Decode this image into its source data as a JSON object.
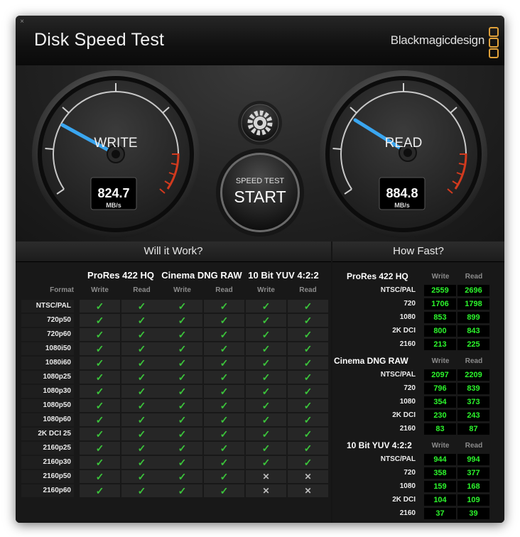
{
  "window": {
    "title": "Disk Speed Test",
    "brand": "Blackmagicdesign",
    "close_glyph": "×"
  },
  "gauges": {
    "write": {
      "label": "WRITE",
      "value": "824.7",
      "unit": "MB/s"
    },
    "read": {
      "label": "READ",
      "value": "884.8",
      "unit": "MB/s"
    },
    "start_button": {
      "top_label": "SPEED TEST",
      "label": "START"
    },
    "settings_icon": "gear-icon"
  },
  "will_it_work": {
    "title": "Will it Work?",
    "format_header": "Format",
    "groups": [
      {
        "name": "ProRes 422 HQ",
        "write": "Write",
        "read": "Read"
      },
      {
        "name": "Cinema DNG RAW",
        "write": "Write",
        "read": "Read"
      },
      {
        "name": "10 Bit YUV 4:2:2",
        "write": "Write",
        "read": "Read"
      }
    ],
    "rows": [
      {
        "format": "NTSC/PAL",
        "cells": [
          "✓",
          "✓",
          "✓",
          "✓",
          "✓",
          "✓"
        ]
      },
      {
        "format": "720p50",
        "cells": [
          "✓",
          "✓",
          "✓",
          "✓",
          "✓",
          "✓"
        ]
      },
      {
        "format": "720p60",
        "cells": [
          "✓",
          "✓",
          "✓",
          "✓",
          "✓",
          "✓"
        ]
      },
      {
        "format": "1080i50",
        "cells": [
          "✓",
          "✓",
          "✓",
          "✓",
          "✓",
          "✓"
        ]
      },
      {
        "format": "1080i60",
        "cells": [
          "✓",
          "✓",
          "✓",
          "✓",
          "✓",
          "✓"
        ]
      },
      {
        "format": "1080p25",
        "cells": [
          "✓",
          "✓",
          "✓",
          "✓",
          "✓",
          "✓"
        ]
      },
      {
        "format": "1080p30",
        "cells": [
          "✓",
          "✓",
          "✓",
          "✓",
          "✓",
          "✓"
        ]
      },
      {
        "format": "1080p50",
        "cells": [
          "✓",
          "✓",
          "✓",
          "✓",
          "✓",
          "✓"
        ]
      },
      {
        "format": "1080p60",
        "cells": [
          "✓",
          "✓",
          "✓",
          "✓",
          "✓",
          "✓"
        ]
      },
      {
        "format": "2K DCI 25",
        "cells": [
          "✓",
          "✓",
          "✓",
          "✓",
          "✓",
          "✓"
        ]
      },
      {
        "format": "2160p25",
        "cells": [
          "✓",
          "✓",
          "✓",
          "✓",
          "✓",
          "✓"
        ]
      },
      {
        "format": "2160p30",
        "cells": [
          "✓",
          "✓",
          "✓",
          "✓",
          "✓",
          "✓"
        ]
      },
      {
        "format": "2160p50",
        "cells": [
          "✓",
          "✓",
          "✓",
          "✓",
          "✕",
          "✕"
        ]
      },
      {
        "format": "2160p60",
        "cells": [
          "✓",
          "✓",
          "✓",
          "✓",
          "✕",
          "✕"
        ]
      }
    ]
  },
  "how_fast": {
    "title": "How Fast?",
    "groups": [
      {
        "name": "ProRes 422 HQ",
        "write": "Write",
        "read": "Read",
        "rows": [
          {
            "format": "NTSC/PAL",
            "write": "2559",
            "read": "2696"
          },
          {
            "format": "720",
            "write": "1706",
            "read": "1798"
          },
          {
            "format": "1080",
            "write": "853",
            "read": "899"
          },
          {
            "format": "2K DCI",
            "write": "800",
            "read": "843"
          },
          {
            "format": "2160",
            "write": "213",
            "read": "225"
          }
        ]
      },
      {
        "name": "Cinema DNG RAW",
        "write": "Write",
        "read": "Read",
        "rows": [
          {
            "format": "NTSC/PAL",
            "write": "2097",
            "read": "2209"
          },
          {
            "format": "720",
            "write": "796",
            "read": "839"
          },
          {
            "format": "1080",
            "write": "354",
            "read": "373"
          },
          {
            "format": "2K DCI",
            "write": "230",
            "read": "243"
          },
          {
            "format": "2160",
            "write": "83",
            "read": "87"
          }
        ]
      },
      {
        "name": "10 Bit YUV 4:2:2",
        "write": "Write",
        "read": "Read",
        "rows": [
          {
            "format": "NTSC/PAL",
            "write": "944",
            "read": "994"
          },
          {
            "format": "720",
            "write": "358",
            "read": "377"
          },
          {
            "format": "1080",
            "write": "159",
            "read": "168"
          },
          {
            "format": "2K DCI",
            "write": "104",
            "read": "109"
          },
          {
            "format": "2160",
            "write": "37",
            "read": "39"
          }
        ]
      }
    ]
  },
  "colors": {
    "value_green": "#2cf52c",
    "check_green": "#3bc43b",
    "needle_blue": "#3aa6f0",
    "redline": "#d23a1e",
    "logo_orange": "#e0a13a"
  }
}
